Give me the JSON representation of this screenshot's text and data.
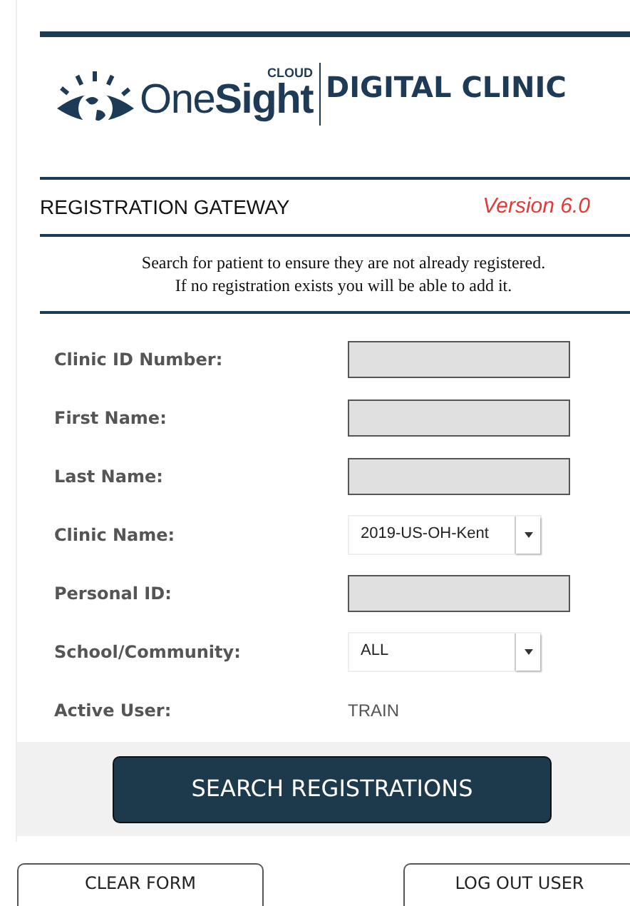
{
  "logo": {
    "cloud": "CLOUD",
    "brand_light": "One",
    "brand_bold": "Sight",
    "product": "DIGITAL CLINIC"
  },
  "header": {
    "title": "REGISTRATION GATEWAY",
    "version": "Version 6.0"
  },
  "intro": [
    "Search for patient to ensure they are not already registered.",
    "If no registration exists you will be able to add it."
  ],
  "fields": [
    {
      "label": "Clinic ID Number:",
      "kind": "text"
    },
    {
      "label": "First Name:",
      "kind": "text"
    },
    {
      "label": "Last Name:",
      "kind": "text"
    },
    {
      "label": "Clinic Name:",
      "kind": "select",
      "value": "2019-US-OH-Kent"
    },
    {
      "label": "Personal ID:",
      "kind": "text"
    },
    {
      "label": "School/Community:",
      "kind": "select",
      "value": "ALL"
    },
    {
      "label": "Active User:",
      "kind": "static",
      "value": "TRAIN"
    }
  ],
  "search_button": "SEARCH REGISTRATIONS",
  "bottom_buttons": [
    "CLEAR FORM",
    "LOG OUT USER"
  ]
}
